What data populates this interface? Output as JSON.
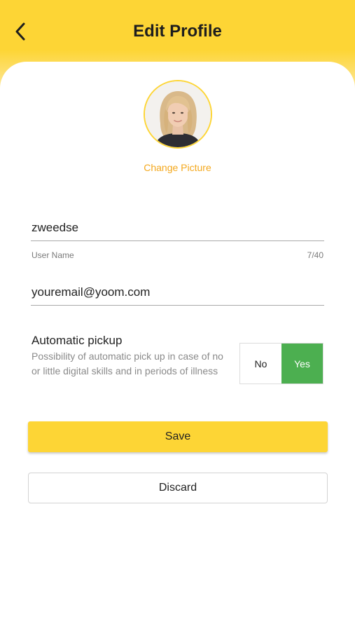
{
  "header": {
    "title": "Edit Profile",
    "back_icon": "chevron-left-icon",
    "background_color": "#fdd535"
  },
  "profile": {
    "change_picture_label": "Change Picture",
    "accent_color": "#f4a81d"
  },
  "form": {
    "username": {
      "value": "zweedse",
      "helper_label": "User Name",
      "counter": "7/40"
    },
    "email": {
      "value": "youremail@yoom.com"
    }
  },
  "pickup": {
    "title": "Automatic pickup",
    "description": "Possibility of automatic pick up in case of no or little digital skills and in periods of illness",
    "options": [
      "No",
      "Yes"
    ],
    "selected": "Yes",
    "selected_color": "#4caf50"
  },
  "actions": {
    "save_label": "Save",
    "discard_label": "Discard"
  }
}
